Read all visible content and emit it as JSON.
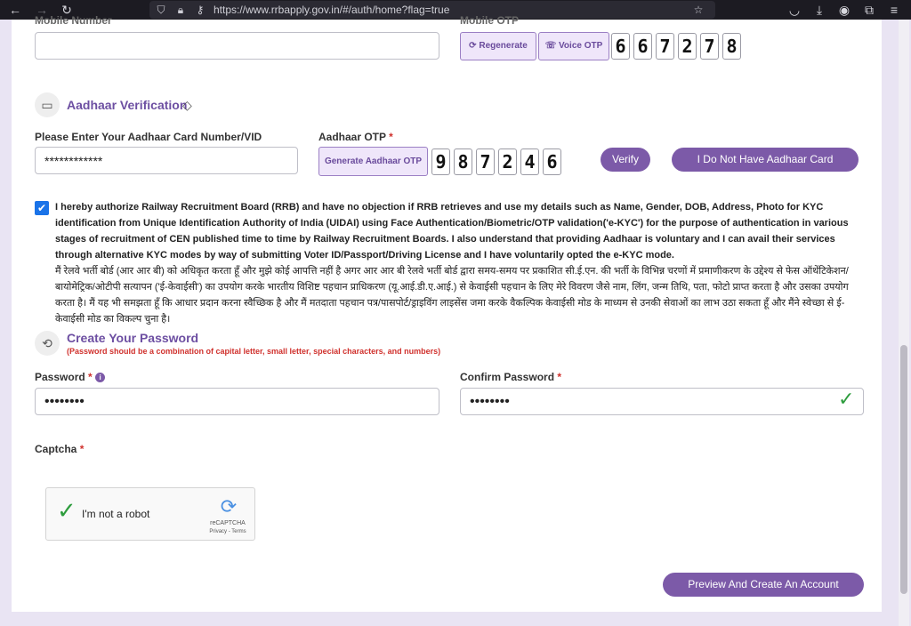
{
  "browser": {
    "url": "https://www.rrbapply.gov.in/#/auth/home?flag=true",
    "icons": [
      "back-icon",
      "forward-icon",
      "reload-icon",
      "shield-icon",
      "lock-icon",
      "key-icon",
      "star-icon",
      "pocket-icon",
      "download-icon",
      "account-icon",
      "extensions-icon",
      "menu-icon"
    ]
  },
  "mobile": {
    "number_label": "Mobile Number",
    "otp_label": "Mobile OTP",
    "regenerate_label": "Regenerate",
    "voice_otp_label": "Voice OTP",
    "otp_digits": [
      "6",
      "6",
      "7",
      "2",
      "7",
      "8"
    ]
  },
  "aadhaar": {
    "section_title": "Aadhaar Verification",
    "number_label": "Please Enter Your Aadhaar Card Number/VID",
    "number_value": "************",
    "otp_label": "Aadhaar OTP",
    "otp_required": "*",
    "generate_label": "Generate Aadhaar OTP",
    "otp_digits": [
      "9",
      "8",
      "7",
      "2",
      "4",
      "6"
    ],
    "verify_label": "Verify",
    "no_aadhaar_label": "I Do Not Have Aadhaar Card"
  },
  "consent": {
    "checked": true,
    "english": "I hereby authorize Railway Recruitment Board (RRB) and have no objection if RRB retrieves and use my details such as Name, Gender, DOB, Address, Photo for KYC identification from Unique Identification Authority of India (UIDAI) using Face Authentication/Biometric/OTP validation('e-KYC') for the purpose of authentication in various stages of recruitment of CEN published time to time by Railway Recruitment Boards. I also understand that providing Aadhaar is voluntary and I can avail their services through alternative KYC modes by way of submitting Voter ID/Passport/Driving License and I have voluntarily opted the e-KYC mode.",
    "hindi": "मैं रेलवे भर्ती बोर्ड (आर आर बी) को अधिकृत करता हूँ और मुझे कोई आपत्ति नहीं है अगर आर आर बी रेलवे भर्ती बोर्ड द्वारा समय-समय पर प्रकाशित सी.ई.एन. की भर्ती के विभिन्न चरणों में प्रमाणीकरण के उद्देश्य से फेस ऑथेंटिकेशन/बायोमेट्रिक/ओटीपी सत्यापन ('ई-केवाईसी') का उपयोग करके भारतीय विशिष्ट पहचान प्राधिकरण (यू.आई.डी.ए.आई.) से केवाईसी पहचान के लिए मेरे विवरण जैसे नाम, लिंग, जन्म तिथि, पता, फोटो प्राप्त करता है और उसका उपयोग करता है। मैं यह भी समझता हूँ कि आधार प्रदान करना स्वैच्छिक है और मैं मतदाता पहचान पत्र/पासपोर्ट/ड्राइविंग लाइसेंस जमा करके वैकल्पिक केवाईसी मोड के माध्यम से उनकी सेवाओं का लाभ उठा सकता हूँ और मैंने स्वेच्छा से ई-केवाईसी मोड का विकल्प चुना है।"
  },
  "password_section": {
    "title": "Create Your Password",
    "hint": "(Password should be a combination of capital letter, small letter, special characters, and numbers)",
    "password_label": "Password",
    "password_value": "••••••••",
    "confirm_label": "Confirm Password",
    "confirm_value": "••••••••",
    "required": "*"
  },
  "captcha": {
    "label": "Captcha",
    "required": "*",
    "robot_text": "I'm not a robot",
    "brand": "reCAPTCHA",
    "links": "Privacy - Terms"
  },
  "submit_label": "Preview And Create An Account",
  "colors": {
    "accent": "#7c5aa8",
    "accent_light": "#efe6fa",
    "check_green": "#2e9d3e",
    "required_red": "#d0312d"
  }
}
